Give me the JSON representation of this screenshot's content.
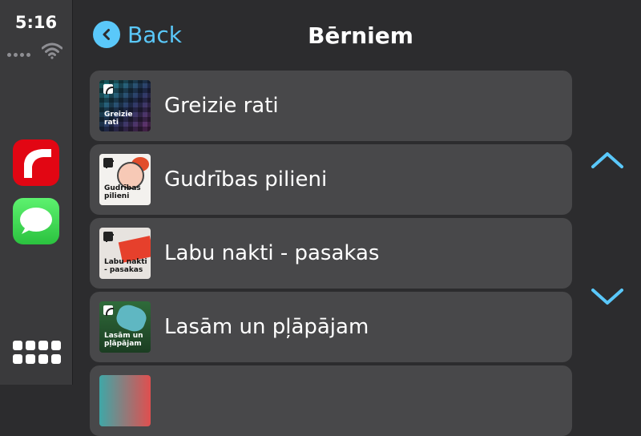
{
  "status": {
    "time": "5:16"
  },
  "dock": {
    "apps": [
      "radio-app-icon",
      "messages-app-icon"
    ],
    "grid": "app-grid-icon"
  },
  "header": {
    "back_label": "Back",
    "title": "Bērniem"
  },
  "list": {
    "items": [
      {
        "label": "Greizie rati",
        "thumb_caption": "Greizie rati"
      },
      {
        "label": "Gudrības pilieni",
        "thumb_caption": "Gudrības pilieni"
      },
      {
        "label": "Labu nakti - pasakas",
        "thumb_caption": "Labu nakti - pasakas"
      },
      {
        "label": "Lasām un pļāpājam",
        "thumb_caption": "Lasām un pļāpājam"
      }
    ]
  },
  "colors": {
    "accent": "#5ac8fa",
    "row_bg": "#48484a",
    "background": "#2c2c2e"
  }
}
